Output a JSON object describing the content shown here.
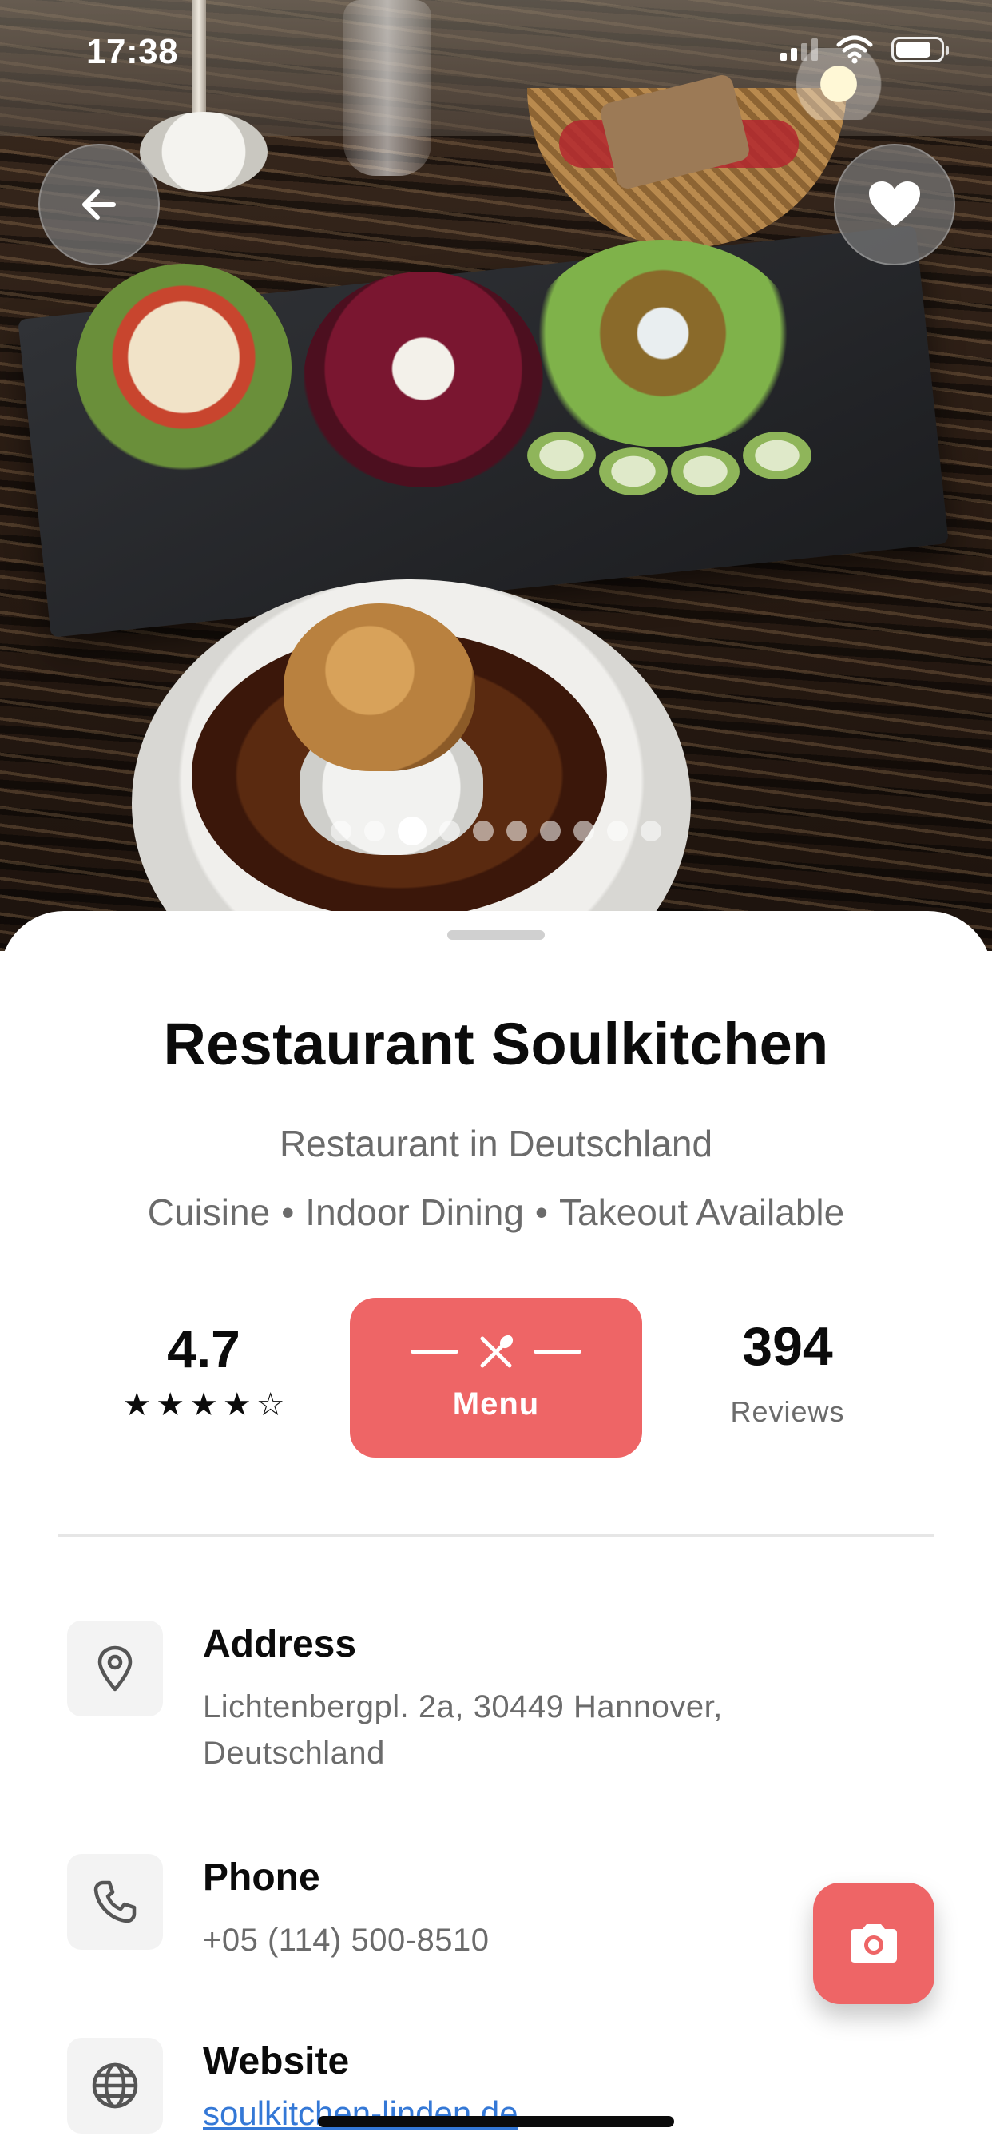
{
  "status_bar": {
    "time": "17:38",
    "battery_percent": 80
  },
  "hero": {
    "carousel": {
      "total": 10,
      "active_index": 2
    },
    "back_icon": "arrow-left-icon",
    "favorite_icon": "heart-icon"
  },
  "restaurant": {
    "name": "Restaurant Soulkitchen",
    "subtitle": "Restaurant in Deutschland",
    "tags": [
      "Cuisine",
      "Indoor Dining",
      "Takeout Available"
    ]
  },
  "stats": {
    "rating": "4.7",
    "rating_stars": 4,
    "rating_stars_max": 5,
    "menu_label": "Menu",
    "menu_icon": "fork-knife-icon",
    "reviews_count": "394",
    "reviews_label": "Reviews"
  },
  "info": {
    "address": {
      "heading": "Address",
      "value": "Lichtenbergpl. 2a, 30449 Hannover, Deutschland",
      "icon": "location-pin-icon"
    },
    "phone": {
      "heading": "Phone",
      "value": "+05 (114) 500-8510",
      "icon": "phone-icon"
    },
    "website": {
      "heading": "Website",
      "value": "soulkitchen-linden.de",
      "icon": "globe-icon"
    }
  },
  "fab": {
    "icon": "camera-icon"
  },
  "colors": {
    "accent": "#ee6566",
    "link": "#3478d6",
    "text": "#0b0b0b",
    "muted": "#6b6b6b"
  }
}
